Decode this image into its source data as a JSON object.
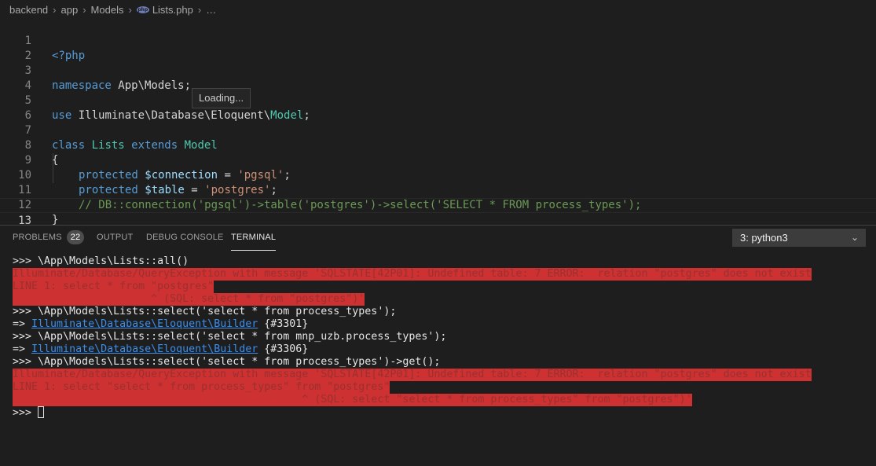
{
  "breadcrumb": {
    "items": [
      "backend",
      "app",
      "Models"
    ],
    "file": "Lists.php",
    "file_icon": "php-icon",
    "ellipsis": "…"
  },
  "editor": {
    "line_numbers": [
      "1",
      "2",
      "3",
      "4",
      "5",
      "6",
      "7",
      "8",
      "9",
      "10",
      "11",
      "12",
      "13"
    ],
    "line1": "<?php",
    "line3_kw": "namespace",
    "line3_ns": " App\\Models;",
    "line5_kw": "use",
    "line5_a": " Illuminate\\Database\\Eloquent\\",
    "line5_cls": "Model",
    "line5_end": ";",
    "line7_kw1": "class",
    "line7_cls": " Lists",
    "line7_kw2": " extends",
    "line7_cls2": " Model",
    "line8": "{",
    "line9_kw": "protected",
    "line9_var": " $connection",
    "line9_eq": " = ",
    "line9_str": "'pgsql'",
    "line9_end": ";",
    "line10_kw": "protected",
    "line10_var": " $table",
    "line10_eq": " = ",
    "line10_str": "'postgres'",
    "line10_end": ";",
    "line11_comment": "// DB::connection('pgsql')->table('postgres')->select('SELECT * FROM process_types');",
    "line12": "}"
  },
  "tooltip": "Loading...",
  "panel": {
    "tabs": [
      "PROBLEMS",
      "OUTPUT",
      "DEBUG CONSOLE",
      "TERMINAL"
    ],
    "problems_count": "22",
    "active_tab": "TERMINAL",
    "terminal_select": "3: python3"
  },
  "terminal": {
    "l1": ">>> \\App\\Models\\Lists::all()",
    "e1a": "Illuminate/Database/QueryException with message 'SQLSTATE[42P01]: Undefined table: 7 ERROR:  relation \"postgres\" does not exist",
    "e1b": "LINE 1: select * from \"postgres\"",
    "e1c": "                      ^ (SQL: select * from \"postgres\")'",
    "l2": ">>> \\App\\Models\\Lists::select('select * from process_types');",
    "l3_prefix": "=> ",
    "l3_link": "Illuminate\\Database\\Eloquent\\Builder",
    "l3_suffix": " {#3301}",
    "l4": ">>> \\App\\Models\\Lists::select('select * from mnp_uzb.process_types');",
    "l5_prefix": "=> ",
    "l5_link": "Illuminate\\Database\\Eloquent\\Builder",
    "l5_suffix": " {#3306}",
    "l6": ">>> \\App\\Models\\Lists::select('select * from process_types')->get();",
    "e2a": "Illuminate/Database/QueryException with message 'SQLSTATE[42P01]: Undefined table: 7 ERROR:  relation \"postgres\" does not exist",
    "e2b": "LINE 1: select \"select * from process_types\" from \"postgres\"",
    "e2c": "                                              ^ (SQL: select \"select * from process_types\" from \"postgres\")'",
    "prompt": ">>> "
  }
}
